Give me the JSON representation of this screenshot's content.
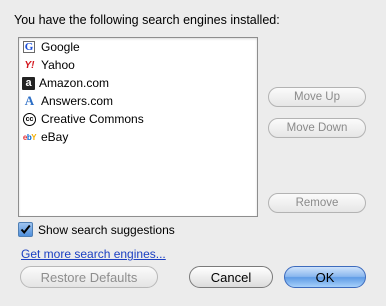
{
  "heading": "You have the following search engines installed:",
  "engines": [
    {
      "label": "Google",
      "icon": "google-icon"
    },
    {
      "label": "Yahoo",
      "icon": "yahoo-icon"
    },
    {
      "label": "Amazon.com",
      "icon": "amazon-icon"
    },
    {
      "label": "Answers.com",
      "icon": "answers-icon"
    },
    {
      "label": "Creative Commons",
      "icon": "creative-commons-icon"
    },
    {
      "label": "eBay",
      "icon": "ebay-icon"
    }
  ],
  "buttons": {
    "move_up": "Move Up",
    "move_down": "Move Down",
    "remove": "Remove",
    "restore_defaults": "Restore Defaults",
    "cancel": "Cancel",
    "ok": "OK"
  },
  "show_suggestions": {
    "label": "Show search suggestions",
    "checked": true
  },
  "more_link": "Get more search engines...",
  "icons": {
    "google": "G",
    "yahoo": "Y!",
    "amazon": "a",
    "answers": "A",
    "cc": "cc",
    "ebay": "ebY"
  },
  "colors": {
    "accent": "#5f9be6",
    "link": "#1b3fc2",
    "disabled_text": "#8a8a8a"
  }
}
